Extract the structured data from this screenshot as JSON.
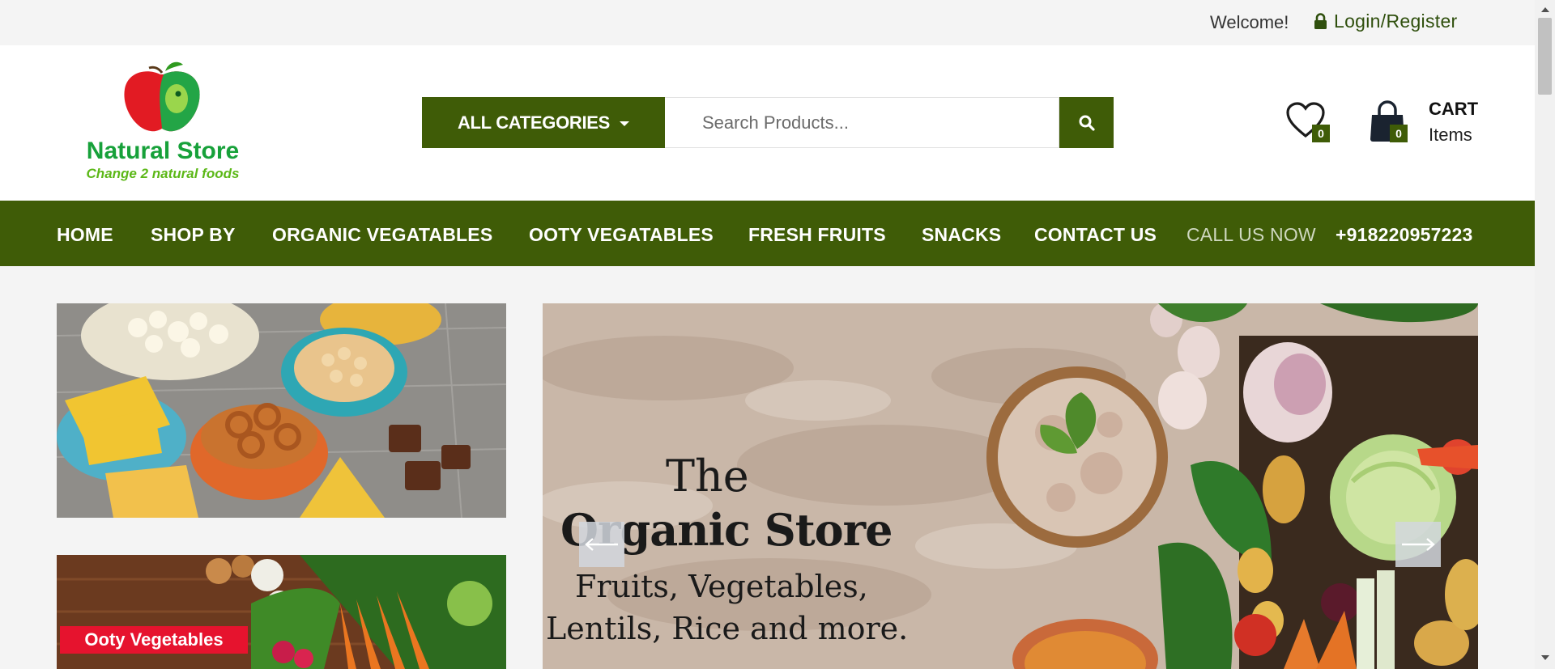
{
  "topbar": {
    "welcome": "Welcome!",
    "login_label": "Login/Register"
  },
  "logo": {
    "name": "Natural Store",
    "tagline": "Change 2 natural foods"
  },
  "search": {
    "category_label": "ALL CATEGORIES",
    "placeholder": "Search Products..."
  },
  "wishlist": {
    "count": "0"
  },
  "cart": {
    "count": "0",
    "title": "CART",
    "subtitle": "Items"
  },
  "nav": {
    "items": [
      "HOME",
      "SHOP BY",
      "ORGANIC VEGATABLES",
      "OOTY VEGATABLES",
      "FRESH FRUITS",
      "SNACKS",
      "CONTACT US"
    ],
    "call_label": "CALL US NOW",
    "phone": "+918220957223"
  },
  "promos": {
    "second_label": "Ooty Vegetables"
  },
  "slider": {
    "line1": "The",
    "line2": "Organic Store",
    "line3": "Fruits, Vegetables,",
    "line4": "Lentils, Rice and more."
  },
  "colors": {
    "brand_green": "#3f5c07",
    "logo_green": "#17a13a",
    "label_red": "#e6132e"
  }
}
